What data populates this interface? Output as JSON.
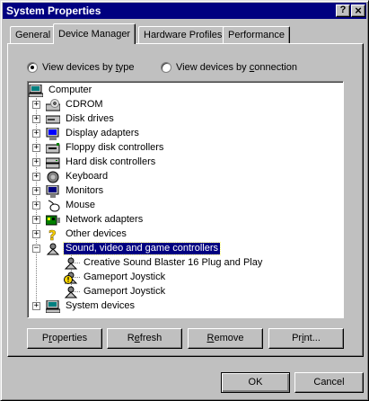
{
  "window": {
    "title": "System Properties",
    "help_glyph": "?",
    "close_glyph": "×"
  },
  "tabs": [
    {
      "label": "General",
      "active": false
    },
    {
      "label": "Device Manager",
      "active": true
    },
    {
      "label": "Hardware Profiles",
      "active": false
    },
    {
      "label": "Performance",
      "active": false
    }
  ],
  "view_options": {
    "by_type": {
      "pre": "View devices by ",
      "key": "t",
      "post": "ype",
      "checked": true
    },
    "by_connection": {
      "pre": "View devices by ",
      "key": "c",
      "post": "onnection",
      "checked": false
    }
  },
  "tree": {
    "root": {
      "label": "Computer",
      "icon": "computer-icon"
    },
    "categories": [
      {
        "label": "CDROM",
        "icon": "cdrom-icon",
        "expander": "+"
      },
      {
        "label": "Disk drives",
        "icon": "disk-drive-icon",
        "expander": "+"
      },
      {
        "label": "Display adapters",
        "icon": "display-adapter-icon",
        "expander": "+"
      },
      {
        "label": "Floppy disk controllers",
        "icon": "floppy-controller-icon",
        "expander": "+"
      },
      {
        "label": "Hard disk controllers",
        "icon": "hard-disk-controller-icon",
        "expander": "+"
      },
      {
        "label": "Keyboard",
        "icon": "keyboard-icon",
        "expander": "+"
      },
      {
        "label": "Monitors",
        "icon": "monitor-icon",
        "expander": "+"
      },
      {
        "label": "Mouse",
        "icon": "mouse-icon",
        "expander": "+"
      },
      {
        "label": "Network adapters",
        "icon": "network-adapter-icon",
        "expander": "+"
      },
      {
        "label": "Other devices",
        "icon": "question-icon",
        "expander": "+"
      },
      {
        "label": "Sound, video and game controllers",
        "icon": "sound-controller-icon",
        "expander": "−",
        "selected": true
      },
      {
        "label": "System devices",
        "icon": "system-devices-icon",
        "expander": "+"
      }
    ],
    "children": [
      {
        "label": "Creative Sound Blaster 16 Plug and Play",
        "icon": "sound-device-icon",
        "warning": false
      },
      {
        "label": "Gameport Joystick",
        "icon": "joystick-warning-icon",
        "warning": true
      },
      {
        "label": "Gameport Joystick",
        "icon": "joystick-icon",
        "warning": false
      }
    ]
  },
  "buttons": {
    "properties": {
      "pre": "P",
      "key": "r",
      "post": "operties"
    },
    "refresh": {
      "pre": "R",
      "key": "e",
      "post": "fresh"
    },
    "remove": {
      "pre": "",
      "key": "R",
      "post": "emove"
    },
    "print": {
      "pre": "Pr",
      "key": "i",
      "post": "nt..."
    },
    "ok": "OK",
    "cancel": "Cancel"
  },
  "colors": {
    "face": "#c0c0c0",
    "titlebar": "#000080",
    "selection": "#000080",
    "warning": "#ffd800"
  }
}
